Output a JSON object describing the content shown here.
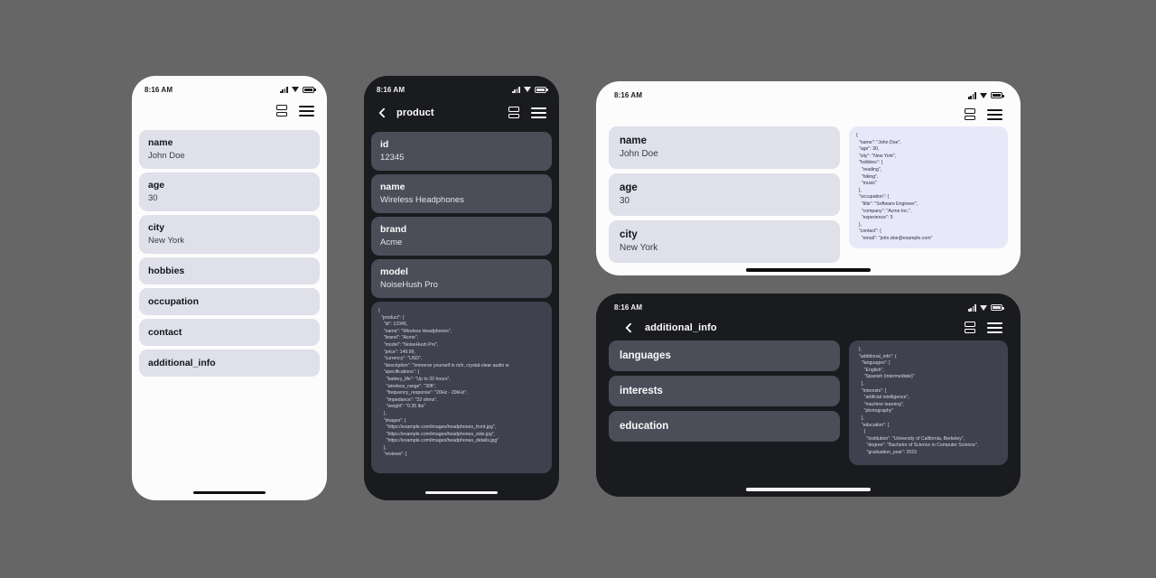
{
  "meta": {
    "background_color": "#666666",
    "light_card_color": "#dfe0ea",
    "dark_card_color": "#4b4e58",
    "light_json_color": "#e7e8f8",
    "dark_json_color": "#3f424e"
  },
  "panels": {
    "phone_light": {
      "theme": "light",
      "status_time": "8:16 AM",
      "appbar": {
        "title": "",
        "icons": [
          "split-view-icon",
          "menu-icon"
        ]
      },
      "fields": [
        {
          "key": "name",
          "value": "John Doe"
        },
        {
          "key": "age",
          "value": "30"
        },
        {
          "key": "city",
          "value": "New York"
        },
        {
          "key": "hobbies",
          "value": ""
        },
        {
          "key": "occupation",
          "value": ""
        },
        {
          "key": "contact",
          "value": ""
        },
        {
          "key": "additional_info",
          "value": ""
        }
      ]
    },
    "phone_dark": {
      "theme": "dark",
      "status_time": "8:16 AM",
      "appbar": {
        "title": "product",
        "icons": [
          "back-icon",
          "split-view-icon",
          "menu-icon"
        ]
      },
      "fields": [
        {
          "key": "id",
          "value": "12345"
        },
        {
          "key": "name",
          "value": "Wireless Headphones"
        },
        {
          "key": "brand",
          "value": "Acme"
        },
        {
          "key": "model",
          "value": "NoiseHush Pro"
        }
      ],
      "json_text": "{\n  \"product\": {\n    \"id\": 12345,\n    \"name\": \"Wireless Headphones\",\n    \"brand\": \"Acme\",\n    \"model\": \"NoiseHush Pro\",\n    \"price\": 149.99,\n    \"currency\": \"USD\",\n    \"description\": \"Immerse yourself in rich, crystal-clear audio w\n    \"specifications\": {\n      \"battery_life\": \"Up to 20 hours\",\n      \"wireless_range\": \"30ft\",\n      \"frequency_response\": \"20Hz - 20kHz\",\n      \"impedance\": \"32 ohms\",\n      \"weight\": \"0.35 lbs\"\n    },\n    \"images\": [\n      \"https://example.com/images/headphones_front.jpg\",\n      \"https://example.com/images/headphones_side.jpg\",\n      \"https://example.com/images/headphones_details.jpg\"\n    ],\n    \"reviews\": ["
    },
    "tablet_light": {
      "theme": "light",
      "status_time": "8:16 AM",
      "appbar": {
        "title": "",
        "icons": [
          "split-view-icon",
          "menu-icon"
        ]
      },
      "fields": [
        {
          "key": "name",
          "value": "John Doe"
        },
        {
          "key": "age",
          "value": "30"
        },
        {
          "key": "city",
          "value": "New York"
        }
      ],
      "json_text": "{\n  \"name\": \"John Doe\",\n  \"age\": 30,\n  \"city\": \"New York\",\n  \"hobbies\": [\n    \"reading\",\n    \"hiking\",\n    \"music\"\n  ],\n  \"occupation\": {\n    \"title\": \"Software Engineer\",\n    \"company\": \"Acme Inc.\",\n    \"experience\": 5\n  },\n  \"contact\": {\n    \"email\": \"john.doe@example.com\""
    },
    "tablet_dark": {
      "theme": "dark",
      "status_time": "8:16 AM",
      "appbar": {
        "title": "additional_info",
        "icons": [
          "back-icon",
          "split-view-icon",
          "menu-icon"
        ]
      },
      "fields": [
        {
          "key": "languages",
          "value": ""
        },
        {
          "key": "interests",
          "value": ""
        },
        {
          "key": "education",
          "value": ""
        }
      ],
      "json_text": "  },\n  \"additional_info\": {\n    \"languages\": [\n      \"English\",\n      \"Spanish (intermediate)\"\n    ],\n    \"interests\": [\n      \"artificial intelligence\",\n      \"machine learning\",\n      \"photography\"\n    ],\n    \"education\": [\n      {\n        \"institution\": \"University of California, Berkeley\",\n        \"degree\": \"Bachelor of Science in Computer Science\",\n        \"graduation_year\": 2015"
    }
  }
}
